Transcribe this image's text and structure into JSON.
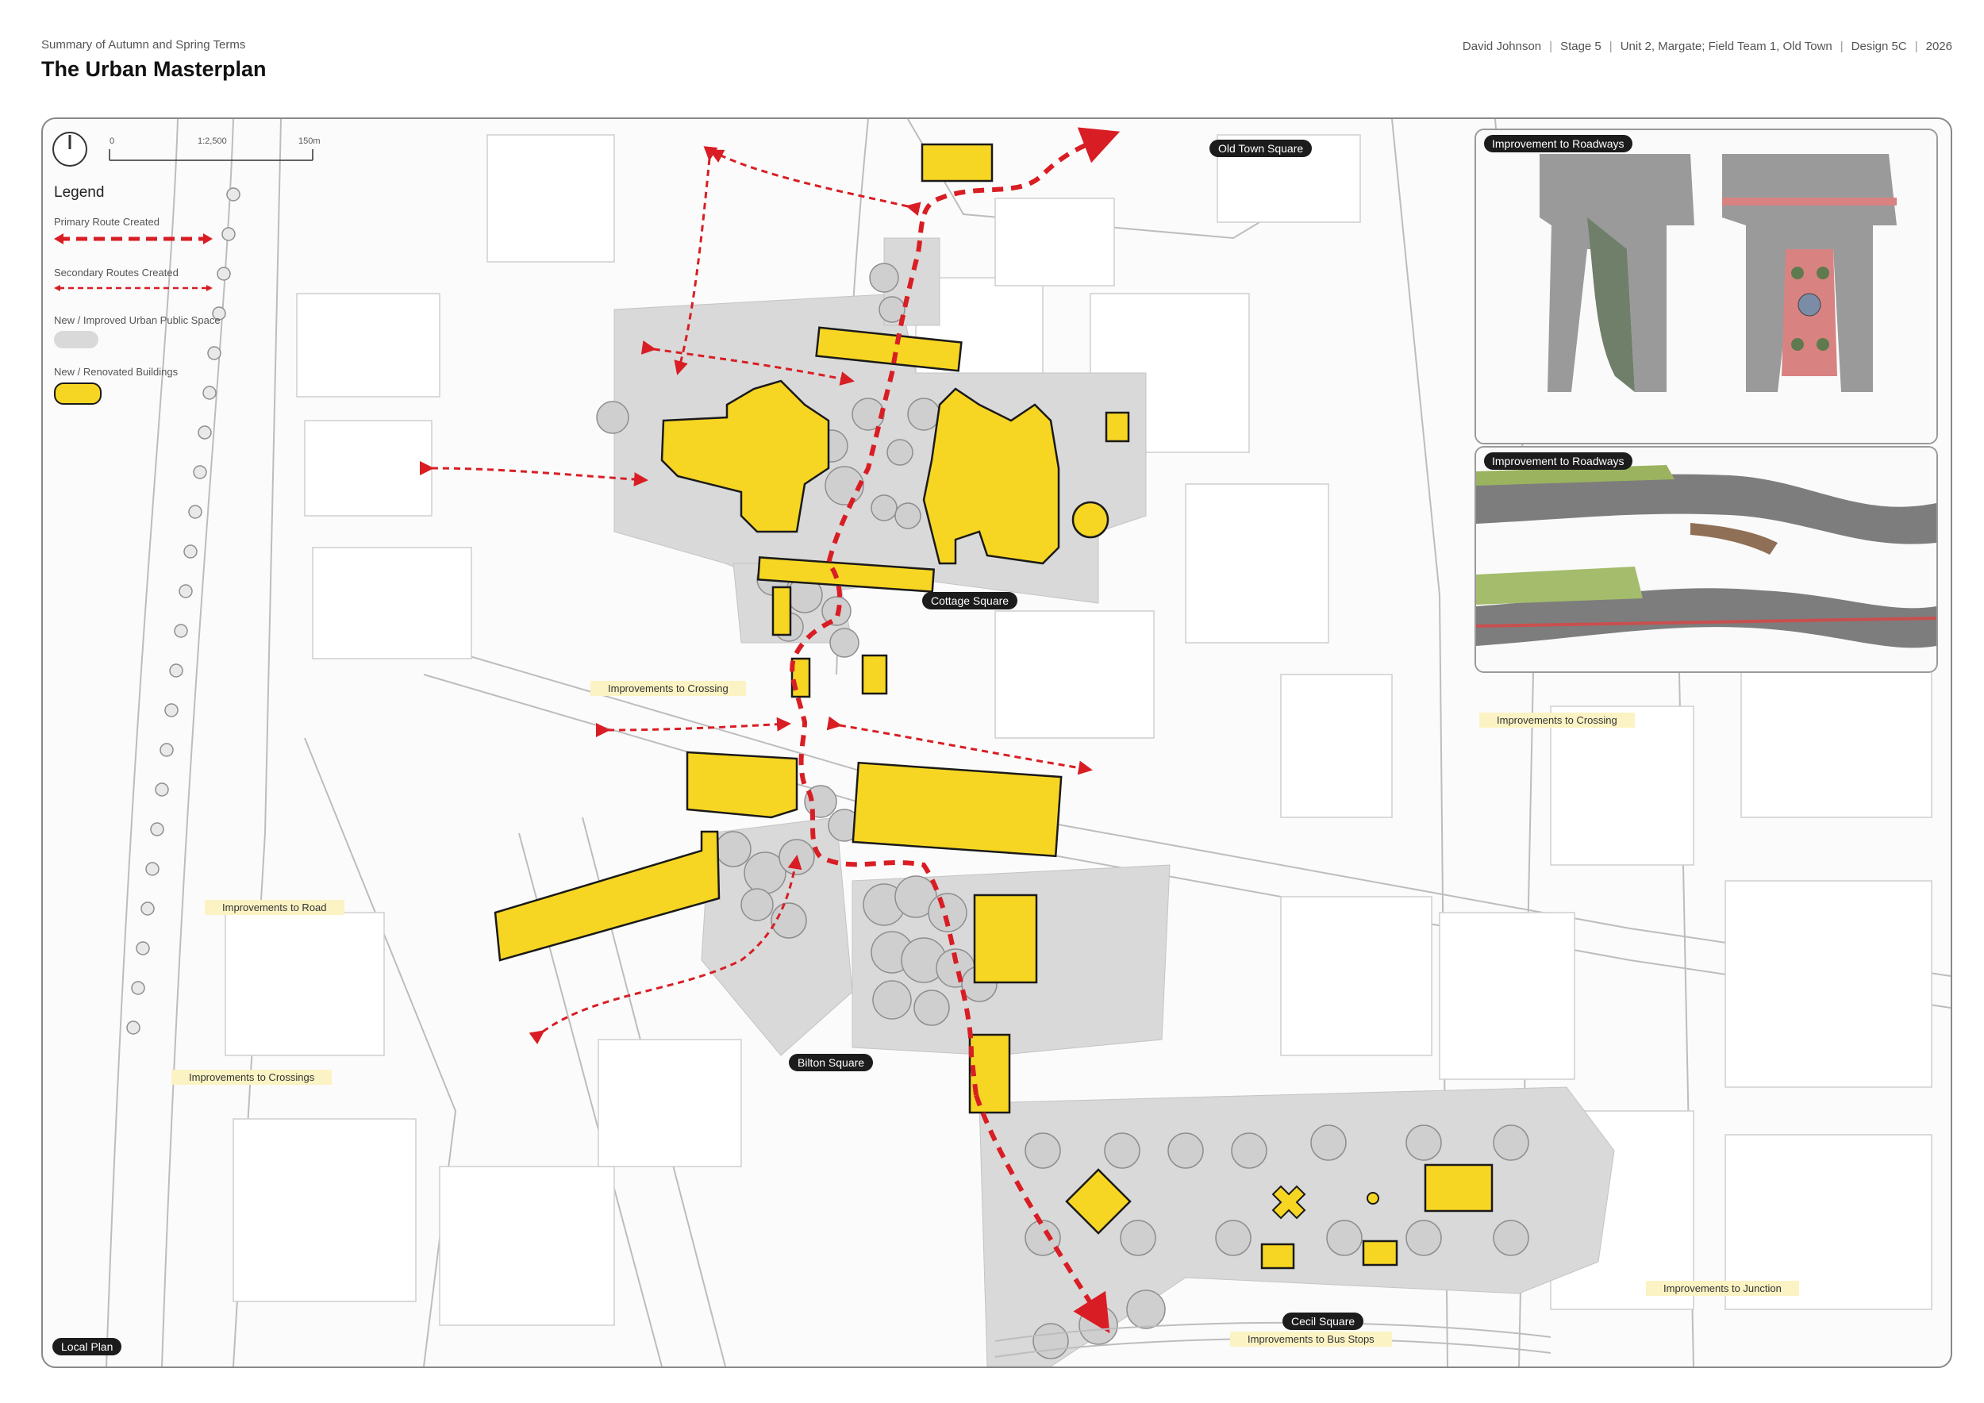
{
  "header": {
    "subtitle": "Summary of Autumn and Spring Terms",
    "title": "The Urban Masterplan",
    "meta": [
      "David Johnson",
      "Stage 5",
      "Unit 2, Margate; Field Team 1, Old Town",
      "Design 5C",
      "2026"
    ]
  },
  "scale": {
    "start": "0",
    "ratio": "1:2,500",
    "end": "150m"
  },
  "legend": {
    "title": "Legend",
    "items": [
      {
        "label": "Primary Route Created",
        "kind": "primary-route"
      },
      {
        "label": "Secondary Routes Created",
        "kind": "secondary-route"
      },
      {
        "label": "New / Improved Urban Public Space",
        "kind": "public-space"
      },
      {
        "label": "New / Renovated Buildings",
        "kind": "building"
      }
    ]
  },
  "places": {
    "old_town_square": "Old Town Square",
    "cottage_square": "Cottage Square",
    "bilton_square": "Bilton Square",
    "cecil_square": "Cecil Square",
    "local_plan": "Local Plan"
  },
  "improvements": {
    "crossing_west": "Improvements to Crossing",
    "crossing_east": "Improvements to Crossing",
    "road": "Improvements to Road",
    "crossings": "Improvements to Crossings",
    "junction": "Improvements to Junction",
    "bus_stops": "Improvements to Bus Stops"
  },
  "insets": {
    "roadways_top": "Improvement to Roadways",
    "roadways_bottom": "Improvement to Roadways"
  },
  "colors": {
    "building_yellow": "#f7d623",
    "route_red": "#d81e24",
    "public_space_grey": "#d9d9d9",
    "label_dark": "#1c1c1c",
    "label_yellow": "#fbf3c4"
  }
}
